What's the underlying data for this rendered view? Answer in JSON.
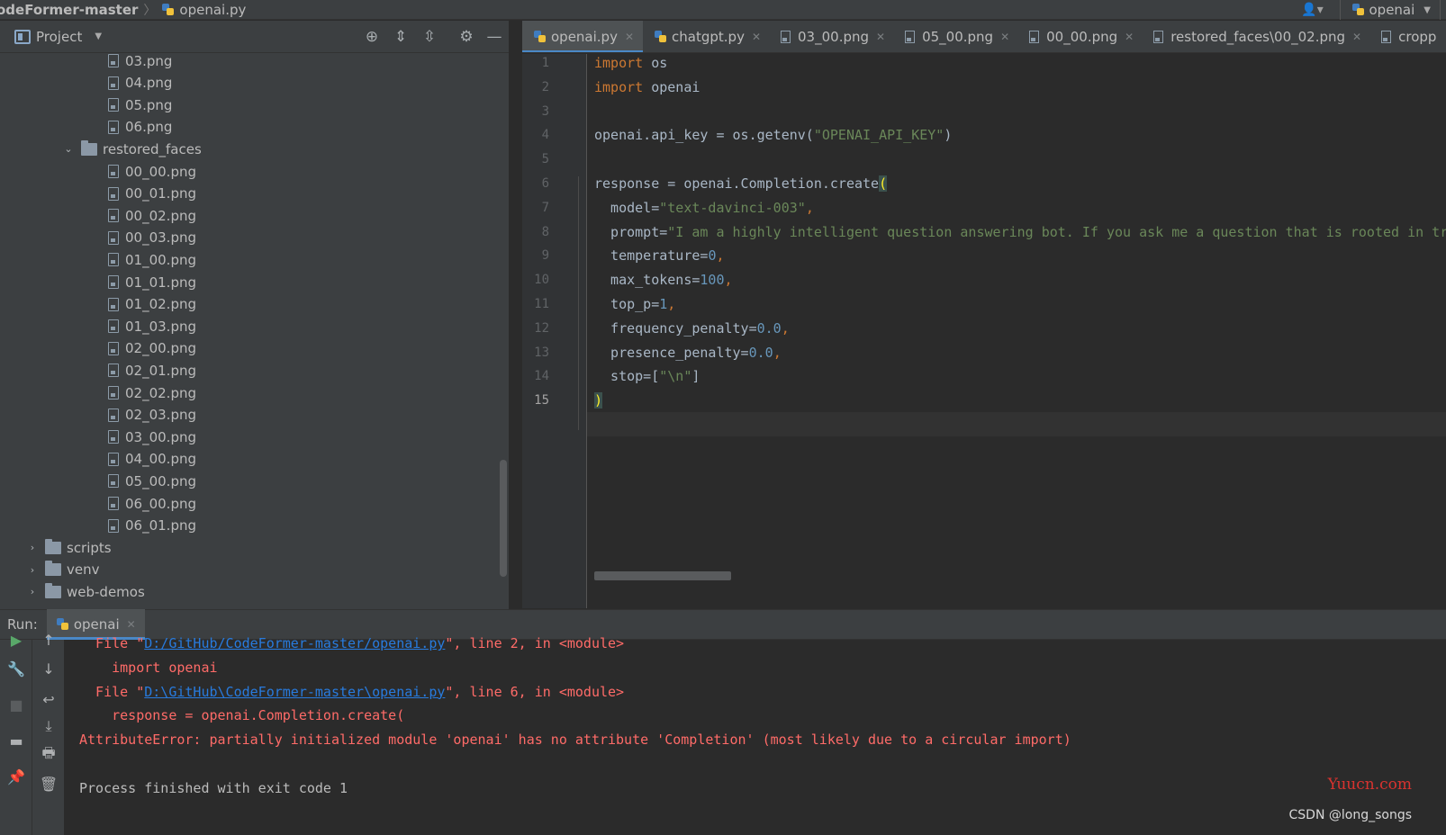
{
  "breadcrumb": {
    "project": "odeFormer-master",
    "file": "openai.py"
  },
  "run_config": {
    "name": "openai"
  },
  "project_panel": {
    "title": "Project",
    "tree": [
      {
        "type": "file",
        "name": "03.png",
        "level": 3
      },
      {
        "type": "file",
        "name": "04.png",
        "level": 3
      },
      {
        "type": "file",
        "name": "05.png",
        "level": 3
      },
      {
        "type": "file",
        "name": "06.png",
        "level": 3
      },
      {
        "type": "folder",
        "name": "restored_faces",
        "level": 2,
        "expanded": true
      },
      {
        "type": "file",
        "name": "00_00.png",
        "level": 3
      },
      {
        "type": "file",
        "name": "00_01.png",
        "level": 3
      },
      {
        "type": "file",
        "name": "00_02.png",
        "level": 3
      },
      {
        "type": "file",
        "name": "00_03.png",
        "level": 3
      },
      {
        "type": "file",
        "name": "01_00.png",
        "level": 3
      },
      {
        "type": "file",
        "name": "01_01.png",
        "level": 3
      },
      {
        "type": "file",
        "name": "01_02.png",
        "level": 3
      },
      {
        "type": "file",
        "name": "01_03.png",
        "level": 3
      },
      {
        "type": "file",
        "name": "02_00.png",
        "level": 3
      },
      {
        "type": "file",
        "name": "02_01.png",
        "level": 3
      },
      {
        "type": "file",
        "name": "02_02.png",
        "level": 3
      },
      {
        "type": "file",
        "name": "02_03.png",
        "level": 3
      },
      {
        "type": "file",
        "name": "03_00.png",
        "level": 3
      },
      {
        "type": "file",
        "name": "04_00.png",
        "level": 3
      },
      {
        "type": "file",
        "name": "05_00.png",
        "level": 3
      },
      {
        "type": "file",
        "name": "06_00.png",
        "level": 3
      },
      {
        "type": "file",
        "name": "06_01.png",
        "level": 3
      },
      {
        "type": "folder",
        "name": "scripts",
        "level": 1,
        "expanded": false
      },
      {
        "type": "folder",
        "name": "venv",
        "level": 1,
        "expanded": false
      },
      {
        "type": "folder",
        "name": "web-demos",
        "level": 1,
        "expanded": false
      }
    ]
  },
  "editor_tabs": [
    {
      "label": "openai.py",
      "kind": "python",
      "active": true
    },
    {
      "label": "chatgpt.py",
      "kind": "python",
      "active": false
    },
    {
      "label": "03_00.png",
      "kind": "image",
      "active": false
    },
    {
      "label": "05_00.png",
      "kind": "image",
      "active": false
    },
    {
      "label": "00_00.png",
      "kind": "image",
      "active": false
    },
    {
      "label": "restored_faces\\00_02.png",
      "kind": "image",
      "active": false
    },
    {
      "label": "cropp",
      "kind": "image",
      "active": false
    }
  ],
  "editor": {
    "current_line": 15,
    "lines": [
      [
        {
          "t": "import",
          "c": "kw"
        },
        {
          "t": " os",
          "c": ""
        }
      ],
      [
        {
          "t": "import",
          "c": "kw"
        },
        {
          "t": " openai",
          "c": ""
        }
      ],
      [],
      [
        {
          "t": "openai.api_key = os.getenv(",
          "c": ""
        },
        {
          "t": "\"OPENAI_API_KEY\"",
          "c": "str"
        },
        {
          "t": ")",
          "c": ""
        }
      ],
      [],
      [
        {
          "t": "response = openai.Completion.create",
          "c": ""
        },
        {
          "t": "(",
          "c": "paren-hl"
        }
      ],
      [
        {
          "t": "  model=",
          "c": ""
        },
        {
          "t": "\"text-davinci-003\"",
          "c": "str"
        },
        {
          "t": ",",
          "c": "kw"
        }
      ],
      [
        {
          "t": "  prompt=",
          "c": ""
        },
        {
          "t": "\"I am a highly intelligent question answering bot. If you ask me a question that is rooted in truth",
          "c": "str"
        }
      ],
      [
        {
          "t": "  temperature=",
          "c": ""
        },
        {
          "t": "0",
          "c": "num"
        },
        {
          "t": ",",
          "c": "kw"
        }
      ],
      [
        {
          "t": "  max_tokens=",
          "c": ""
        },
        {
          "t": "100",
          "c": "num"
        },
        {
          "t": ",",
          "c": "kw"
        }
      ],
      [
        {
          "t": "  top_p=",
          "c": ""
        },
        {
          "t": "1",
          "c": "num"
        },
        {
          "t": ",",
          "c": "kw"
        }
      ],
      [
        {
          "t": "  frequency_penalty=",
          "c": ""
        },
        {
          "t": "0.0",
          "c": "num"
        },
        {
          "t": ",",
          "c": "kw"
        }
      ],
      [
        {
          "t": "  presence_penalty=",
          "c": ""
        },
        {
          "t": "0.0",
          "c": "num"
        },
        {
          "t": ",",
          "c": "kw"
        }
      ],
      [
        {
          "t": "  stop=[",
          "c": ""
        },
        {
          "t": "\"\\n\"",
          "c": "str"
        },
        {
          "t": "]",
          "c": ""
        }
      ],
      [
        {
          "t": ")",
          "c": "paren-hl"
        }
      ]
    ]
  },
  "run": {
    "label": "Run:",
    "tab": "openai",
    "console": [
      [
        {
          "t": "  File \"",
          "c": "err"
        },
        {
          "t": "D:/GitHub/CodeFormer-master/openai.py",
          "c": "link"
        },
        {
          "t": "\", line 2, in <module>",
          "c": "err"
        }
      ],
      [
        {
          "t": "    import openai",
          "c": "err"
        }
      ],
      [
        {
          "t": "  File \"",
          "c": "err"
        },
        {
          "t": "D:\\GitHub\\CodeFormer-master\\openai.py",
          "c": "link"
        },
        {
          "t": "\", line 6, in <module>",
          "c": "err"
        }
      ],
      [
        {
          "t": "    response = openai.Completion.create(",
          "c": "err"
        }
      ],
      [
        {
          "t": "AttributeError: partially initialized module 'openai' has no attribute 'Completion' (most likely due to a circular import)",
          "c": "err"
        }
      ],
      [],
      [
        {
          "t": "Process finished with exit code 1",
          "c": "plain"
        }
      ]
    ]
  },
  "watermarks": {
    "site": "Yuucn.com",
    "author": "CSDN @long_songs"
  },
  "colors": {
    "accent": "#4a88c7",
    "error": "#ff6b68",
    "link": "#287bde",
    "keyword": "#cc7832",
    "string": "#6a8759",
    "number": "#6897bb"
  }
}
